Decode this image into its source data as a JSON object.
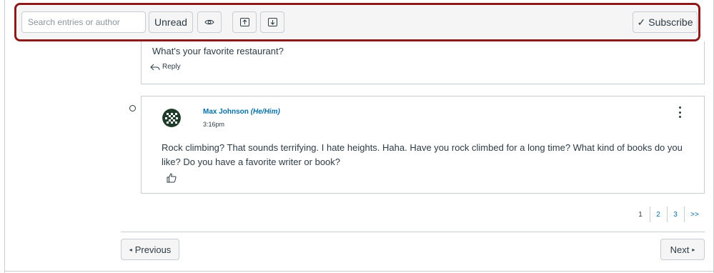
{
  "toolbar": {
    "search_placeholder": "Search entries or author",
    "unread_label": "Unread",
    "subscribe_label": "Subscribe",
    "subscribe_check": "✓"
  },
  "reply_entry": {
    "text": "What's your favorite restaurant?",
    "reply_label": "Reply"
  },
  "entry": {
    "author_name": "Max Johnson",
    "author_pronouns": "(He/Him)",
    "time": "3:16pm",
    "message": "Rock climbing? That sounds terrifying. I hate heights. Haha. Have you rock climbed for a long time? What kind of books do you like? Do you have a favorite writer or book?"
  },
  "pagination": {
    "pages": [
      "1",
      "2",
      "3"
    ],
    "current": "1",
    "next_label": ">>"
  },
  "nav": {
    "previous_label": "Previous",
    "next_label": "Next",
    "previous_arrow": "◂",
    "next_arrow": "▸"
  },
  "colors": {
    "link": "#0770a3",
    "focus_outline": "#8b1a1a",
    "text": "#2d3b45",
    "border": "#c7cdd1"
  }
}
